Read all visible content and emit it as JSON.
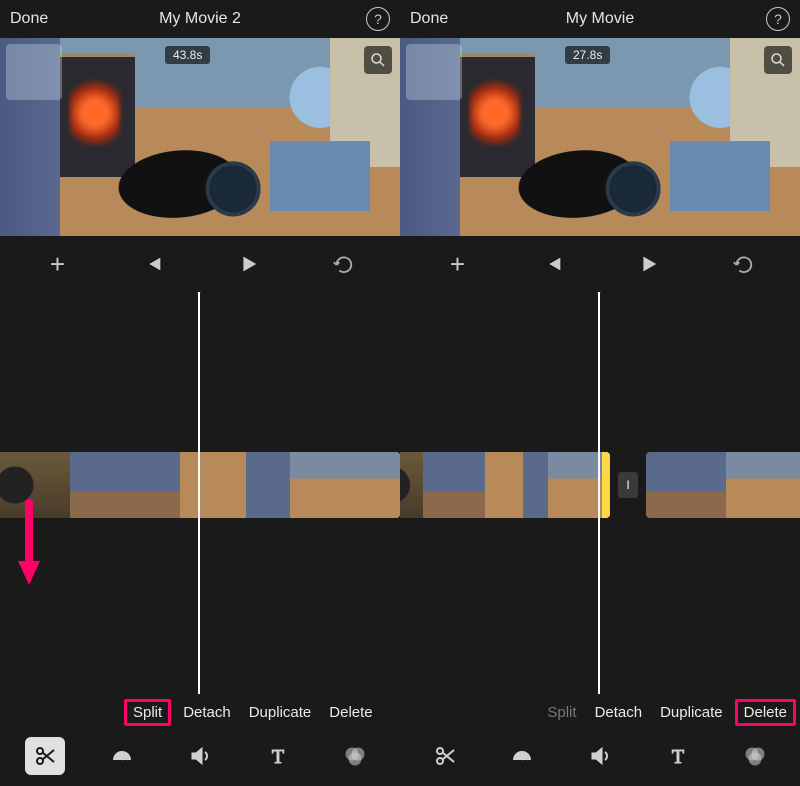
{
  "left": {
    "done_label": "Done",
    "title": "My Movie 2",
    "timestamp": "43.8s",
    "actions": {
      "split": "Split",
      "detach": "Detach",
      "duplicate": "Duplicate",
      "delete": "Delete"
    },
    "highlighted_action": "split",
    "tools": [
      "scissors",
      "speed",
      "volume",
      "text",
      "filters"
    ],
    "selected_tool": "scissors"
  },
  "right": {
    "done_label": "Done",
    "title": "My Movie",
    "timestamp": "27.8s",
    "actions": {
      "split": "Split",
      "detach": "Detach",
      "duplicate": "Duplicate",
      "delete": "Delete"
    },
    "split_disabled": true,
    "highlighted_action": "delete",
    "gap_marker": "I",
    "tools": [
      "scissors",
      "speed",
      "volume",
      "text",
      "filters"
    ]
  },
  "icons": {
    "help": "?",
    "plus": "+"
  },
  "colors": {
    "highlight": "#ff0066",
    "selection": "#ffd84a"
  }
}
